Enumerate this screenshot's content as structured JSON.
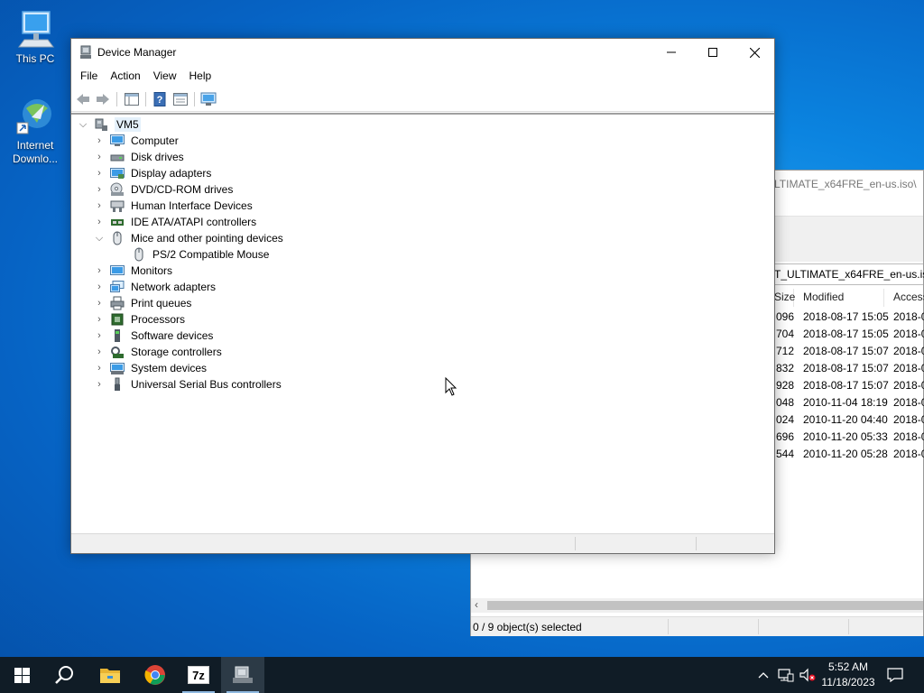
{
  "desktop": {
    "icons": [
      {
        "label_line1": "This PC",
        "label_line2": ""
      },
      {
        "label_line1": "Internet",
        "label_line2": "Downlo..."
      }
    ]
  },
  "zip_window": {
    "path_top": "LTIMATE_x64FRE_en-us.iso\\",
    "path_bar": "T_ULTIMATE_x64FRE_en-us.iso\\",
    "columns": [
      "Size",
      "Modified",
      "Access"
    ],
    "rows": [
      {
        "size": "096",
        "modified": "2018-08-17 15:05",
        "accessed": "2018-0"
      },
      {
        "size": "704",
        "modified": "2018-08-17 15:05",
        "accessed": "2018-0"
      },
      {
        "size": "712",
        "modified": "2018-08-17 15:07",
        "accessed": "2018-0"
      },
      {
        "size": "832",
        "modified": "2018-08-17 15:07",
        "accessed": "2018-0"
      },
      {
        "size": "928",
        "modified": "2018-08-17 15:07",
        "accessed": "2018-0"
      },
      {
        "size": "048",
        "modified": "2010-11-04 18:19",
        "accessed": "2018-0"
      },
      {
        "size": "024",
        "modified": "2010-11-20 04:40",
        "accessed": "2018-0"
      },
      {
        "size": "696",
        "modified": "2010-11-20 05:33",
        "accessed": "2018-0"
      },
      {
        "size": "544",
        "modified": "2010-11-20 05:28",
        "accessed": "2018-0"
      }
    ],
    "status": "0 / 9 object(s) selected"
  },
  "device_manager": {
    "title": "Device Manager",
    "menu": [
      "File",
      "Action",
      "View",
      "Help"
    ],
    "root": "VM5",
    "nodes": [
      {
        "label": "Computer",
        "icon": "computer-icon"
      },
      {
        "label": "Disk drives",
        "icon": "disk-drive-icon"
      },
      {
        "label": "Display adapters",
        "icon": "display-adapter-icon"
      },
      {
        "label": "DVD/CD-ROM drives",
        "icon": "dvd-drive-icon"
      },
      {
        "label": "Human Interface Devices",
        "icon": "hid-icon"
      },
      {
        "label": "IDE ATA/ATAPI controllers",
        "icon": "ide-controller-icon"
      },
      {
        "label": "Mice and other pointing devices",
        "icon": "mouse-icon",
        "expanded": true
      },
      {
        "label": "PS/2 Compatible Mouse",
        "icon": "mouse-icon",
        "child": true
      },
      {
        "label": "Monitors",
        "icon": "monitor-icon"
      },
      {
        "label": "Network adapters",
        "icon": "network-adapter-icon"
      },
      {
        "label": "Print queues",
        "icon": "printer-icon"
      },
      {
        "label": "Processors",
        "icon": "processor-icon"
      },
      {
        "label": "Software devices",
        "icon": "software-device-icon"
      },
      {
        "label": "Storage controllers",
        "icon": "storage-controller-icon"
      },
      {
        "label": "System devices",
        "icon": "system-devices-icon"
      },
      {
        "label": "Universal Serial Bus controllers",
        "icon": "usb-icon"
      }
    ]
  },
  "taskbar": {
    "time": "5:52 AM",
    "date": "11/18/2023",
    "apps": [
      "start-icon",
      "search-icon",
      "file-explorer-icon",
      "chrome-icon",
      "7zip-icon",
      "device-manager-icon"
    ],
    "zip_label": "7z"
  },
  "colors": {
    "accent": "#0078d7",
    "taskbar": "#101c26",
    "desktop": "#0b84e0"
  }
}
